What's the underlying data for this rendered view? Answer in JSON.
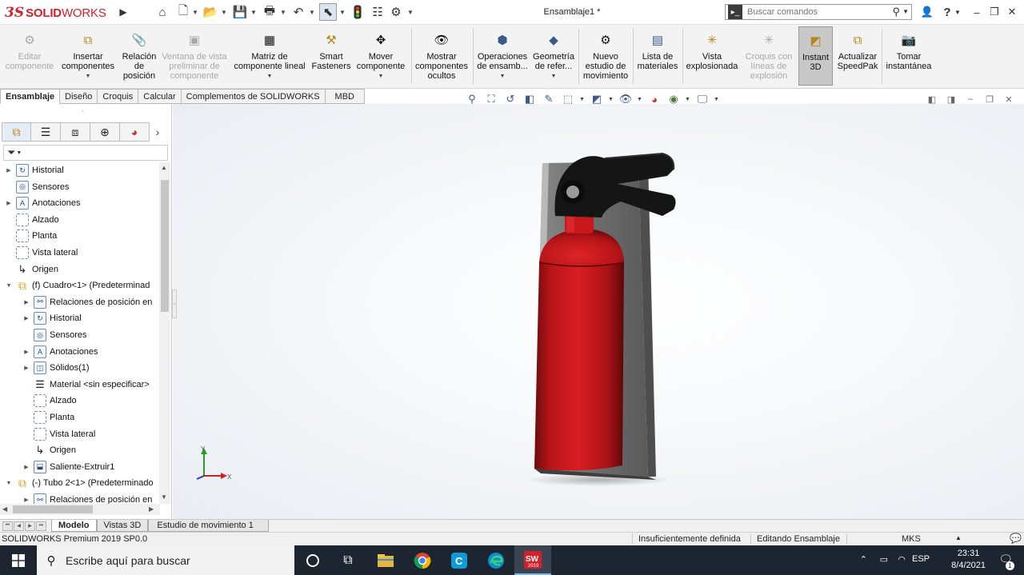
{
  "app": {
    "logo_ds": "3S",
    "logo_solid": "SOLID",
    "logo_works": "WORKS",
    "document_title": "Ensamblaje1 *"
  },
  "search": {
    "placeholder": "Buscar comandos"
  },
  "commands": [
    {
      "label": "Editar componente",
      "enabled": false
    },
    {
      "label": "Insertar componentes",
      "enabled": true
    },
    {
      "label": "Relación de posición",
      "enabled": true
    },
    {
      "label": "Ventana de vista preliminar de componente",
      "enabled": false
    },
    {
      "label": "Matriz de componente lineal",
      "enabled": true
    },
    {
      "label": "Smart Fasteners",
      "enabled": true
    },
    {
      "label": "Mover componente",
      "enabled": true
    },
    {
      "label": "Mostrar componentes ocultos",
      "enabled": true
    },
    {
      "label": "Operaciones de ensamb...",
      "enabled": true
    },
    {
      "label": "Geometría de refer...",
      "enabled": true
    },
    {
      "label": "Nuevo estudio de movimiento",
      "enabled": true
    },
    {
      "label": "Lista de materiales",
      "enabled": true
    },
    {
      "label": "Vista explosionada",
      "enabled": true
    },
    {
      "label": "Croquis con líneas de explosión",
      "enabled": false
    },
    {
      "label": "Instant 3D",
      "enabled": true,
      "active": true
    },
    {
      "label": "Actualizar SpeedPak",
      "enabled": true
    },
    {
      "label": "Tomar instantánea",
      "enabled": true
    }
  ],
  "tabs": [
    "Ensamblaje",
    "Diseño",
    "Croquis",
    "Calcular",
    "Complementos de SOLIDWORKS",
    "MBD"
  ],
  "tree": [
    "Historial",
    "Sensores",
    "Anotaciones",
    "Alzado",
    "Planta",
    "Vista lateral",
    "Origen",
    "(f) Cuadro<1> (Predeterminad",
    "Relaciones de posición en",
    "Historial",
    "Sensores",
    "Anotaciones",
    "Sólidos(1)",
    "Material <sin especificar>",
    "Alzado",
    "Planta",
    "Vista lateral",
    "Origen",
    "Saliente-Extruir1",
    "(-) Tubo 2<1> (Predeterminado",
    "Relaciones de posición en"
  ],
  "triad": {
    "y": "Y",
    "x": "X"
  },
  "bottom_tabs": [
    "Modelo",
    "Vistas 3D",
    "Estudio de movimiento 1"
  ],
  "status": {
    "product": "SOLIDWORKS Premium 2019 SP0.0",
    "definition": "Insuficientemente definida",
    "mode": "Editando Ensamblaje",
    "units": "MKS"
  },
  "taskbar": {
    "search_placeholder": "Escribe aquí para buscar",
    "sw_badge": "2019",
    "lang": "ESP",
    "time": "23:31",
    "date": "8/4/2021",
    "notif_count": "1"
  },
  "colors": {
    "brand": "#d4202a",
    "extinguisher": "#c8161b",
    "bracket": "#7a7a7a",
    "taskbar": "#1d2530"
  }
}
